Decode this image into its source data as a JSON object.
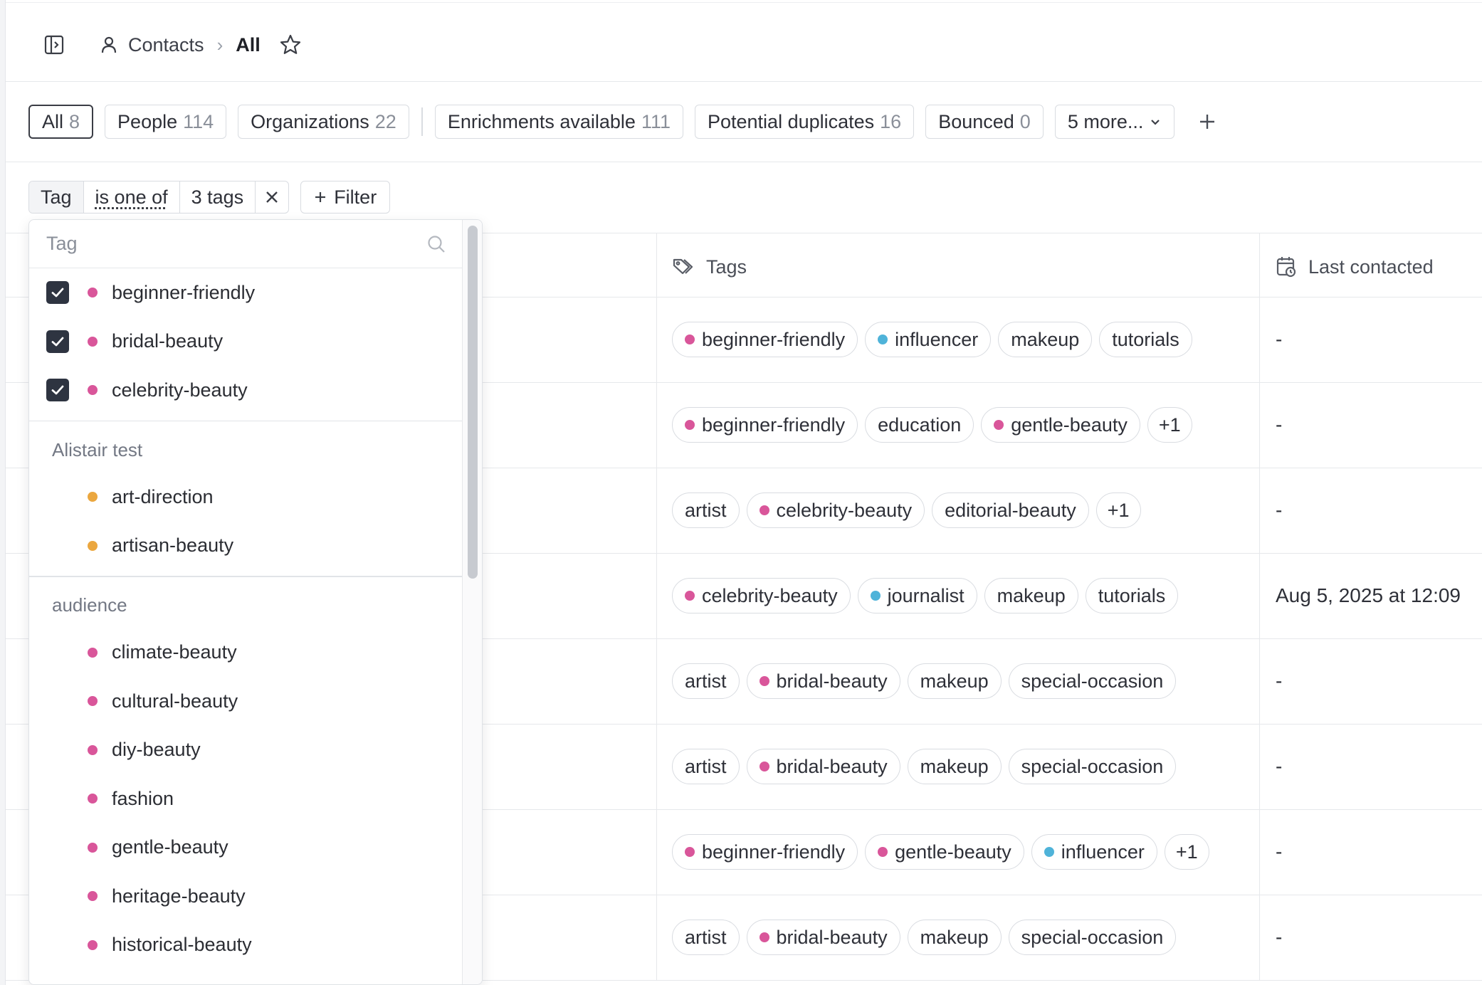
{
  "header": {
    "breadcrumb_root": "Contacts",
    "breadcrumb_separator": "›",
    "breadcrumb_current": "All"
  },
  "views": [
    {
      "label": "All",
      "count": "8",
      "active": true
    },
    {
      "label": "People",
      "count": "114"
    },
    {
      "label": "Organizations",
      "count": "22"
    },
    {
      "label": "Enrichments available",
      "count": "111"
    },
    {
      "label": "Potential duplicates",
      "count": "16"
    },
    {
      "label": "Bounced",
      "count": "0"
    },
    {
      "label": "5 more..."
    }
  ],
  "filter": {
    "field": "Tag",
    "operator": "is one of",
    "value": "3 tags",
    "add_label": "Filter"
  },
  "table": {
    "columns": {
      "tags": "Tags",
      "last_contacted": "Last contacted"
    },
    "rows": [
      {
        "tags": [
          {
            "t": "beginner-friendly",
            "c": "pink"
          },
          {
            "t": "influencer",
            "c": "blue"
          },
          {
            "t": "makeup"
          },
          {
            "t": "tutorials"
          }
        ],
        "last": "-"
      },
      {
        "tags": [
          {
            "t": "beginner-friendly",
            "c": "pink"
          },
          {
            "t": "education"
          },
          {
            "t": "gentle-beauty",
            "c": "pink"
          },
          {
            "t": "+1",
            "more": true
          }
        ],
        "last": "-"
      },
      {
        "tags": [
          {
            "t": "artist"
          },
          {
            "t": "celebrity-beauty",
            "c": "pink"
          },
          {
            "t": "editorial-beauty"
          },
          {
            "t": "+1",
            "more": true
          }
        ],
        "last": "-"
      },
      {
        "tags": [
          {
            "t": "celebrity-beauty",
            "c": "pink"
          },
          {
            "t": "journalist",
            "c": "blue"
          },
          {
            "t": "makeup"
          },
          {
            "t": "tutorials"
          }
        ],
        "last": "Aug 5, 2025 at 12:09"
      },
      {
        "tags": [
          {
            "t": "artist"
          },
          {
            "t": "bridal-beauty",
            "c": "pink"
          },
          {
            "t": "makeup"
          },
          {
            "t": "special-occasion"
          }
        ],
        "last": "-"
      },
      {
        "tags": [
          {
            "t": "artist"
          },
          {
            "t": "bridal-beauty",
            "c": "pink"
          },
          {
            "t": "makeup"
          },
          {
            "t": "special-occasion"
          }
        ],
        "last": "-"
      },
      {
        "tags": [
          {
            "t": "beginner-friendly",
            "c": "pink"
          },
          {
            "t": "gentle-beauty",
            "c": "pink"
          },
          {
            "t": "influencer",
            "c": "blue"
          },
          {
            "t": "+1",
            "more": true
          }
        ],
        "last": "-"
      },
      {
        "tags": [
          {
            "t": "artist"
          },
          {
            "t": "bridal-beauty",
            "c": "pink"
          },
          {
            "t": "makeup"
          },
          {
            "t": "special-occasion"
          }
        ],
        "last": "-"
      }
    ]
  },
  "dropdown": {
    "search_placeholder": "Tag",
    "selected": [
      {
        "label": "beginner-friendly",
        "color": "pink"
      },
      {
        "label": "bridal-beauty",
        "color": "pink"
      },
      {
        "label": "celebrity-beauty",
        "color": "pink"
      }
    ],
    "groups": [
      {
        "name": "Alistair test",
        "items": [
          {
            "label": "art-direction",
            "color": "orange"
          },
          {
            "label": "artisan-beauty",
            "color": "orange"
          }
        ]
      },
      {
        "name": "audience",
        "items": [
          {
            "label": "climate-beauty",
            "color": "pink"
          },
          {
            "label": "cultural-beauty",
            "color": "pink"
          },
          {
            "label": "diy-beauty",
            "color": "pink"
          },
          {
            "label": "fashion",
            "color": "pink"
          },
          {
            "label": "gentle-beauty",
            "color": "pink"
          },
          {
            "label": "heritage-beauty",
            "color": "pink"
          },
          {
            "label": "historical-beauty",
            "color": "pink"
          }
        ]
      }
    ]
  },
  "colors": {
    "pink": "#d9569a",
    "blue": "#4fb3d9",
    "orange": "#eba73f",
    "checkbox": "#2e3441"
  },
  "icons": {
    "sidebar_toggle": "sidebar-toggle-icon",
    "contacts": "person-icon",
    "favorite": "star-icon",
    "add_view": "plus-icon",
    "clear_filter": "close-icon",
    "search": "search-icon",
    "tags_column": "tag-icon",
    "last_contacted_column": "calendar-clock-icon"
  }
}
